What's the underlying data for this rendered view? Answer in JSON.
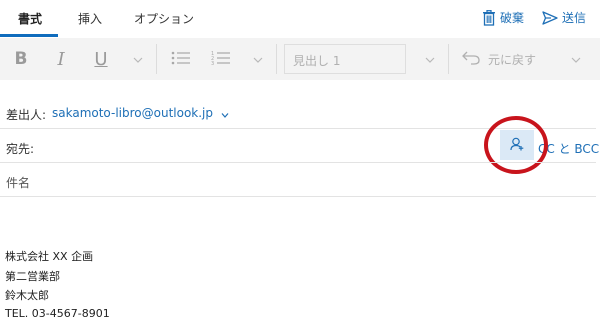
{
  "tabs": [
    {
      "label": "書式",
      "active": true
    },
    {
      "label": "挿入",
      "active": false
    },
    {
      "label": "オプション",
      "active": false
    }
  ],
  "actions": {
    "discard_label": "破棄",
    "send_label": "送信",
    "discard_icon": "trash-icon",
    "send_icon": "send-icon"
  },
  "toolbar": {
    "bold": "B",
    "italic": "I",
    "underline": "U",
    "style_value": "見出し 1",
    "undo_label": "元に戻す"
  },
  "compose": {
    "from_label": "差出人:",
    "from_address": "sakamoto-libro@outlook.jp",
    "to_label": "宛先:",
    "cc_bcc_label": "CC と BCC",
    "subject_placeholder": "件名"
  },
  "signature": {
    "lines": [
      "株式会社 XX 企画",
      "第二営業部",
      "鈴木太郎",
      "TEL. 03-4567-8901"
    ]
  },
  "colors": {
    "accent": "#1e6fb6",
    "highlight_ring": "#c8141c",
    "toolbar_bg": "#f3f3f3"
  }
}
